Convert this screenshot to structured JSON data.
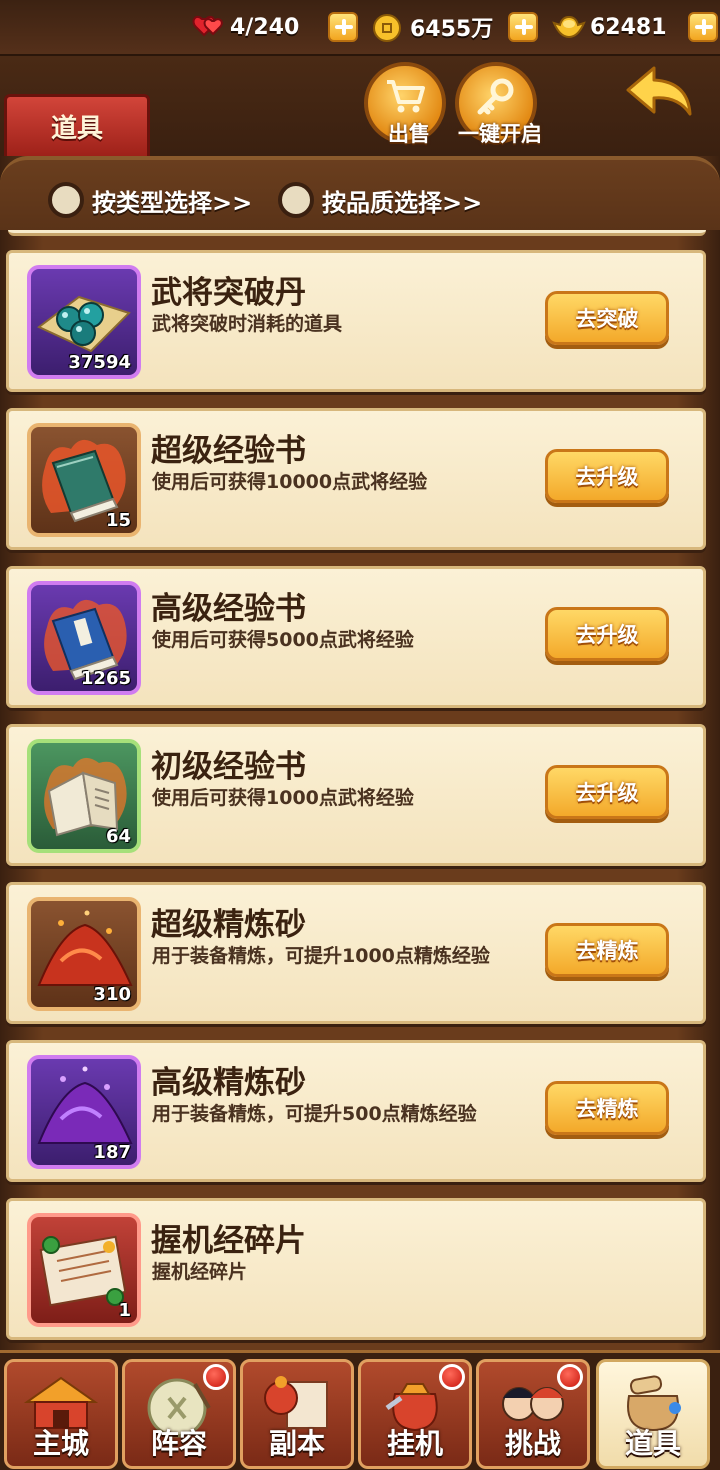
{
  "resources": {
    "stamina": "4/240",
    "coins": "6455万",
    "ingots": "62481"
  },
  "header": {
    "title": "道具",
    "sell_label": "出售",
    "open_all_label": "一键开启"
  },
  "filters": {
    "by_type": "按类型选择>>",
    "by_quality": "按品质选择>>"
  },
  "items": [
    {
      "name": "武将突破丹",
      "desc": "武将突破时消耗的道具",
      "count": "37594",
      "action": "去突破",
      "quality": "purple",
      "icon": "breakthrough-pill-icon"
    },
    {
      "name": "超级经验书",
      "desc": "使用后可获得10000点武将经验",
      "count": "15",
      "action": "去升级",
      "quality": "orange",
      "icon": "exp-book-icon"
    },
    {
      "name": "高级经验书",
      "desc": "使用后可获得5000点武将经验",
      "count": "1265",
      "action": "去升级",
      "quality": "purple",
      "icon": "exp-book-icon"
    },
    {
      "name": "初级经验书",
      "desc": "使用后可获得1000点武将经验",
      "count": "64",
      "action": "去升级",
      "quality": "green",
      "icon": "exp-book-icon"
    },
    {
      "name": "超级精炼砂",
      "desc": "用于装备精炼，可提升1000点精炼经验",
      "count": "310",
      "action": "去精炼",
      "quality": "orange",
      "icon": "refine-sand-icon"
    },
    {
      "name": "高级精炼砂",
      "desc": "用于装备精炼，可提升500点精炼经验",
      "count": "187",
      "action": "去精炼",
      "quality": "purple",
      "icon": "refine-sand-icon"
    },
    {
      "name": "握机经碎片",
      "desc": "握机经碎片",
      "count": "1",
      "action": "",
      "quality": "red",
      "icon": "scroll-fragment-icon"
    }
  ],
  "nav": {
    "tabs": [
      {
        "label": "主城",
        "badge": false,
        "active": false
      },
      {
        "label": "阵容",
        "badge": true,
        "active": false
      },
      {
        "label": "副本",
        "badge": false,
        "active": false
      },
      {
        "label": "挂机",
        "badge": true,
        "active": false
      },
      {
        "label": "挑战",
        "badge": true,
        "active": false
      },
      {
        "label": "道具",
        "badge": false,
        "active": true
      }
    ]
  },
  "colors": {
    "accent": "#f3a92a",
    "panel": "#f7ebcc",
    "frame": "#4a2a14"
  }
}
